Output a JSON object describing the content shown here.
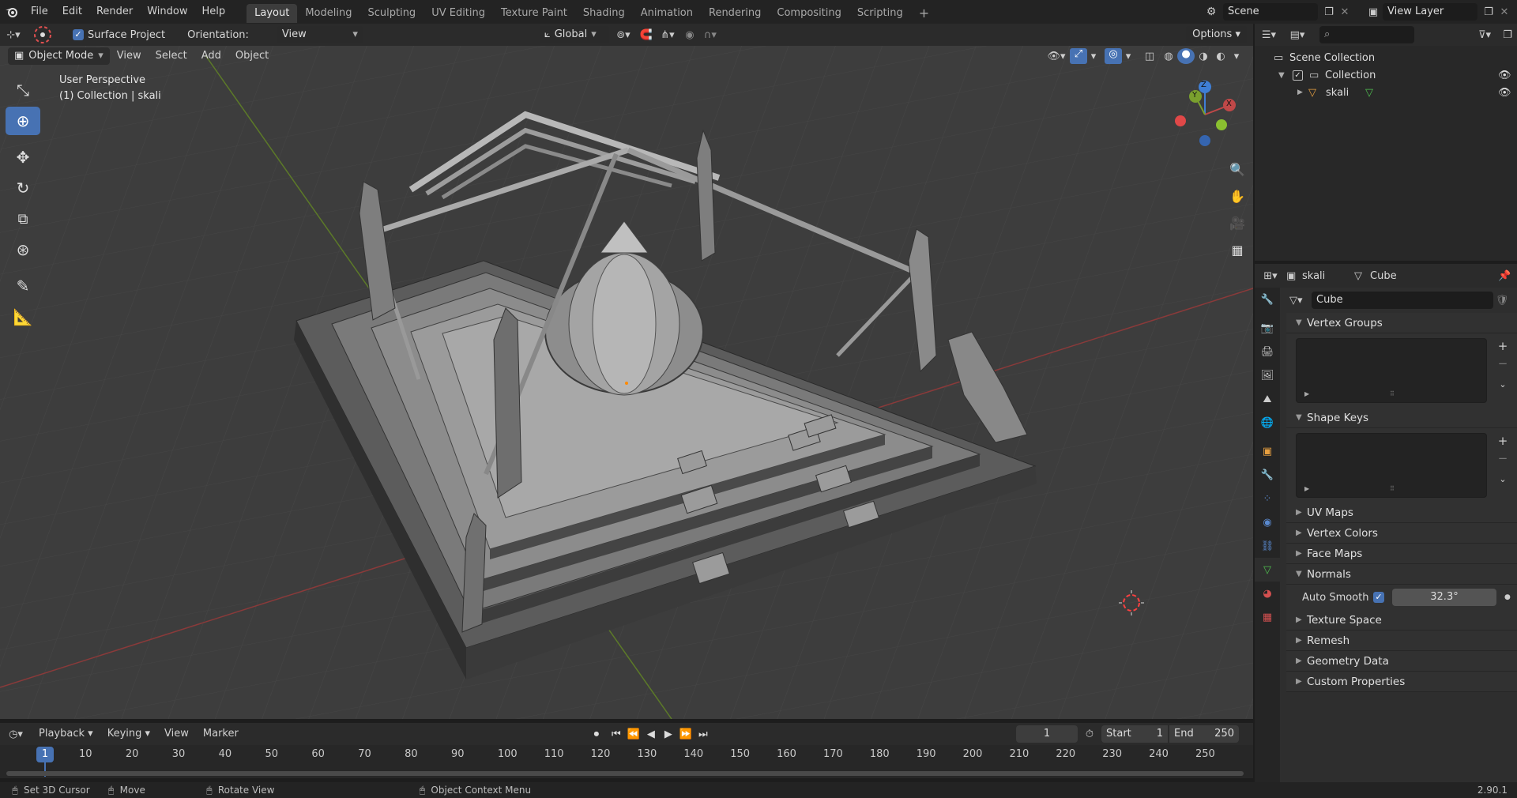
{
  "topbar": {
    "menus": [
      "File",
      "Edit",
      "Render",
      "Window",
      "Help"
    ],
    "workspaces": [
      "Layout",
      "Modeling",
      "Sculpting",
      "UV Editing",
      "Texture Paint",
      "Shading",
      "Animation",
      "Rendering",
      "Compositing",
      "Scripting"
    ],
    "active_workspace": "Layout",
    "add_workspace": "+",
    "scene": "Scene",
    "view_layer": "View Layer"
  },
  "tool_header": {
    "surface_project": "Surface Project",
    "orientation_label": "Orientation:",
    "orientation_value": "View",
    "transform_orientation": "Global",
    "options": "Options"
  },
  "viewport_header": {
    "mode": "Object Mode",
    "menus": [
      "View",
      "Select",
      "Add",
      "Object"
    ]
  },
  "viewport": {
    "perspective": "User Perspective",
    "collection_info": "(1) Collection | skali",
    "gizmo": {
      "x": "X",
      "y": "Y",
      "z": "Z"
    }
  },
  "outliner": {
    "search_placeholder": "",
    "scene_collection": "Scene Collection",
    "collection": "Collection",
    "object": "skali"
  },
  "properties": {
    "object_name": "skali",
    "data_name": "Cube",
    "mesh_name": "Cube",
    "panels": {
      "vertex_groups": "Vertex Groups",
      "shape_keys": "Shape Keys",
      "uv_maps": "UV Maps",
      "vertex_colors": "Vertex Colors",
      "face_maps": "Face Maps",
      "normals": "Normals",
      "auto_smooth": "Auto Smooth",
      "auto_smooth_angle": "32.3°",
      "texture_space": "Texture Space",
      "remesh": "Remesh",
      "geometry_data": "Geometry Data",
      "custom_properties": "Custom Properties"
    }
  },
  "timeline": {
    "menus": [
      "Playback",
      "Keying",
      "View",
      "Marker"
    ],
    "current_frame": "1",
    "start_label": "Start",
    "start": "1",
    "end_label": "End",
    "end": "250",
    "ticks": [
      "1",
      "10",
      "20",
      "30",
      "40",
      "50",
      "60",
      "70",
      "80",
      "90",
      "100",
      "110",
      "120",
      "130",
      "140",
      "150",
      "160",
      "170",
      "180",
      "190",
      "200",
      "210",
      "220",
      "230",
      "240",
      "250"
    ]
  },
  "statusbar": {
    "left_click": "Set 3D Cursor",
    "middle_click": "Move",
    "right_drag": "Rotate View",
    "right_click": "Object Context Menu",
    "version": "2.90.1"
  },
  "colors": {
    "accent": "#4772b3",
    "x_axis": "#9b3b3b",
    "y_axis": "#6a8a2c",
    "z_axis": "#3f7fd6"
  }
}
